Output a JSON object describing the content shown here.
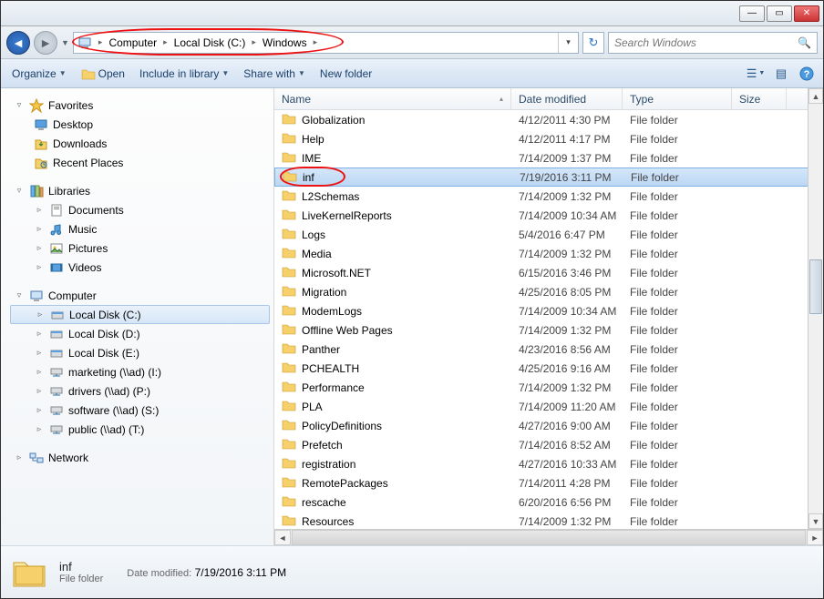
{
  "breadcrumb": [
    "Computer",
    "Local Disk (C:)",
    "Windows"
  ],
  "search_placeholder": "Search Windows",
  "toolbar": {
    "organize": "Organize",
    "open": "Open",
    "include": "Include in library",
    "share": "Share with",
    "newfolder": "New folder"
  },
  "columns": {
    "name": "Name",
    "date": "Date modified",
    "type": "Type",
    "size": "Size"
  },
  "nav": {
    "favorites": "Favorites",
    "fav_items": [
      "Desktop",
      "Downloads",
      "Recent Places"
    ],
    "libraries": "Libraries",
    "lib_items": [
      "Documents",
      "Music",
      "Pictures",
      "Videos"
    ],
    "computer": "Computer",
    "comp_items": [
      "Local Disk (C:)",
      "Local Disk (D:)",
      "Local Disk (E:)",
      "marketing (\\\\ad) (I:)",
      "drivers (\\\\ad) (P:)",
      "software (\\\\ad) (S:)",
      "public (\\\\ad) (T:)"
    ],
    "network": "Network"
  },
  "files": [
    {
      "name": "Globalization",
      "date": "4/12/2011 4:30 PM",
      "type": "File folder"
    },
    {
      "name": "Help",
      "date": "4/12/2011 4:17 PM",
      "type": "File folder"
    },
    {
      "name": "IME",
      "date": "7/14/2009 1:37 PM",
      "type": "File folder"
    },
    {
      "name": "inf",
      "date": "7/19/2016 3:11 PM",
      "type": "File folder",
      "selected": true,
      "circled": true
    },
    {
      "name": "L2Schemas",
      "date": "7/14/2009 1:32 PM",
      "type": "File folder"
    },
    {
      "name": "LiveKernelReports",
      "date": "7/14/2009 10:34 AM",
      "type": "File folder"
    },
    {
      "name": "Logs",
      "date": "5/4/2016 6:47 PM",
      "type": "File folder"
    },
    {
      "name": "Media",
      "date": "7/14/2009 1:32 PM",
      "type": "File folder"
    },
    {
      "name": "Microsoft.NET",
      "date": "6/15/2016 3:46 PM",
      "type": "File folder"
    },
    {
      "name": "Migration",
      "date": "4/25/2016 8:05 PM",
      "type": "File folder"
    },
    {
      "name": "ModemLogs",
      "date": "7/14/2009 10:34 AM",
      "type": "File folder"
    },
    {
      "name": "Offline Web Pages",
      "date": "7/14/2009 1:32 PM",
      "type": "File folder"
    },
    {
      "name": "Panther",
      "date": "4/23/2016 8:56 AM",
      "type": "File folder"
    },
    {
      "name": "PCHEALTH",
      "date": "4/25/2016 9:16 AM",
      "type": "File folder"
    },
    {
      "name": "Performance",
      "date": "7/14/2009 1:32 PM",
      "type": "File folder"
    },
    {
      "name": "PLA",
      "date": "7/14/2009 11:20 AM",
      "type": "File folder"
    },
    {
      "name": "PolicyDefinitions",
      "date": "4/27/2016 9:00 AM",
      "type": "File folder"
    },
    {
      "name": "Prefetch",
      "date": "7/14/2016 8:52 AM",
      "type": "File folder"
    },
    {
      "name": "registration",
      "date": "4/27/2016 10:33 AM",
      "type": "File folder"
    },
    {
      "name": "RemotePackages",
      "date": "7/14/2011 4:28 PM",
      "type": "File folder"
    },
    {
      "name": "rescache",
      "date": "6/20/2016 6:56 PM",
      "type": "File folder"
    },
    {
      "name": "Resources",
      "date": "7/14/2009 1:32 PM",
      "type": "File folder"
    }
  ],
  "details": {
    "name": "inf",
    "type": "File folder",
    "modlabel": "Date modified:",
    "modval": "7/19/2016 3:11 PM"
  }
}
